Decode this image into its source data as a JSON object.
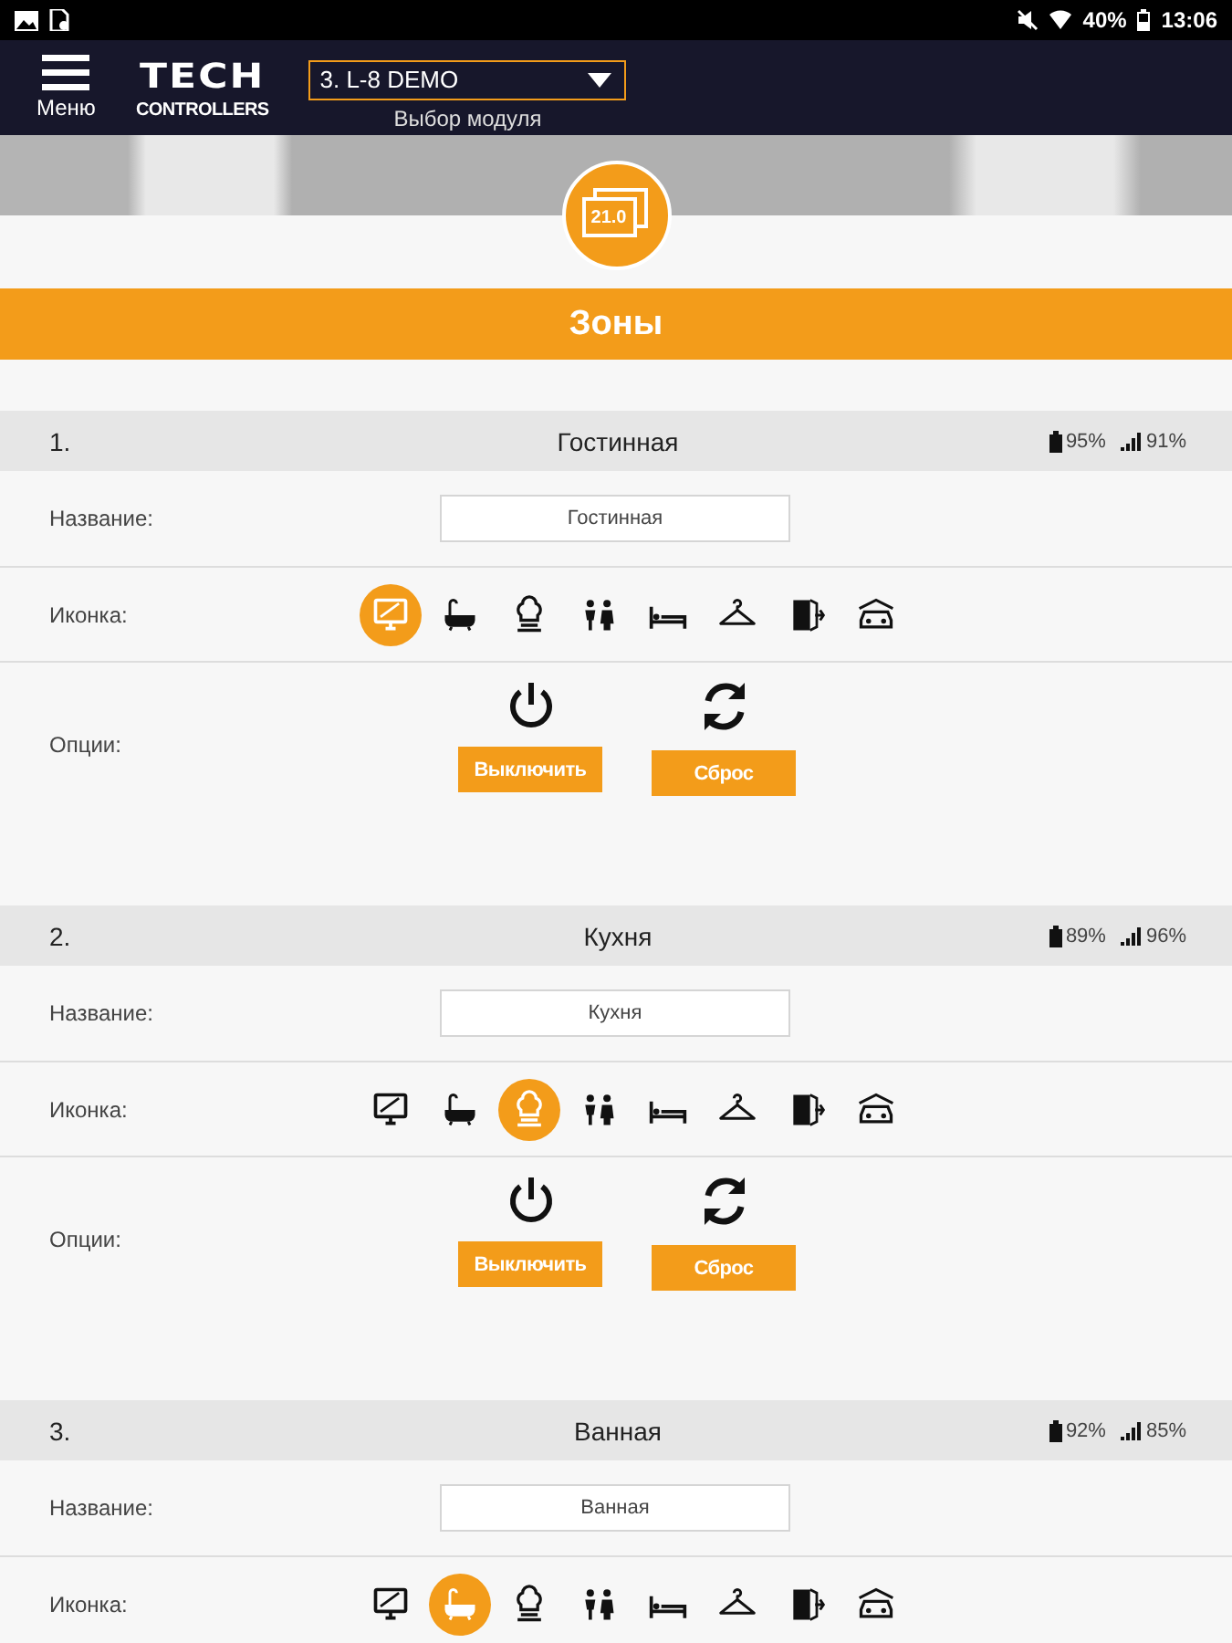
{
  "status_bar": {
    "battery": "40%",
    "time": "13:06"
  },
  "header": {
    "menu_label": "Меню",
    "logo_top": "TECH",
    "logo_bottom": "CONTROLLERS",
    "module_select": {
      "value": "3. L-8 DEMO",
      "label": "Выбор модуля"
    }
  },
  "badge": {
    "temperature": "21.0"
  },
  "section_title": "Зоны",
  "zones": [
    {
      "number": "1.",
      "name": "Гостинная",
      "battery": "95%",
      "signal": "91%",
      "name_label": "Название:",
      "name_value": "Гостинная",
      "icon_label": "Иконка:",
      "icons": [
        {
          "selected": true
        },
        {
          "selected": false
        },
        {
          "selected": false
        },
        {
          "selected": false
        },
        {
          "selected": false
        },
        {
          "selected": false
        },
        {
          "selected": false
        },
        {
          "selected": false
        }
      ],
      "options_label": "Опции:",
      "buttons": [
        "Выключить",
        "Сброс"
      ]
    },
    {
      "number": "2.",
      "name": "Кухня",
      "battery": "89%",
      "signal": "96%",
      "name_label": "Название:",
      "name_value": "Кухня",
      "icon_label": "Иконка:",
      "icons": [
        {
          "selected": false
        },
        {
          "selected": false
        },
        {
          "selected": true
        },
        {
          "selected": false
        },
        {
          "selected": false
        },
        {
          "selected": false
        },
        {
          "selected": false
        },
        {
          "selected": false
        }
      ],
      "options_label": "Опции:",
      "buttons": [
        "Выключить",
        "Сброс"
      ]
    },
    {
      "number": "3.",
      "name": "Ванная",
      "battery": "92%",
      "signal": "85%",
      "name_label": "Название:",
      "name_value": "Ванная",
      "icon_label": "Иконка:",
      "icons": [
        {
          "selected": false
        },
        {
          "selected": true
        },
        {
          "selected": false
        },
        {
          "selected": false
        },
        {
          "selected": false
        },
        {
          "selected": false
        },
        {
          "selected": false
        },
        {
          "selected": false
        }
      ]
    }
  ]
}
